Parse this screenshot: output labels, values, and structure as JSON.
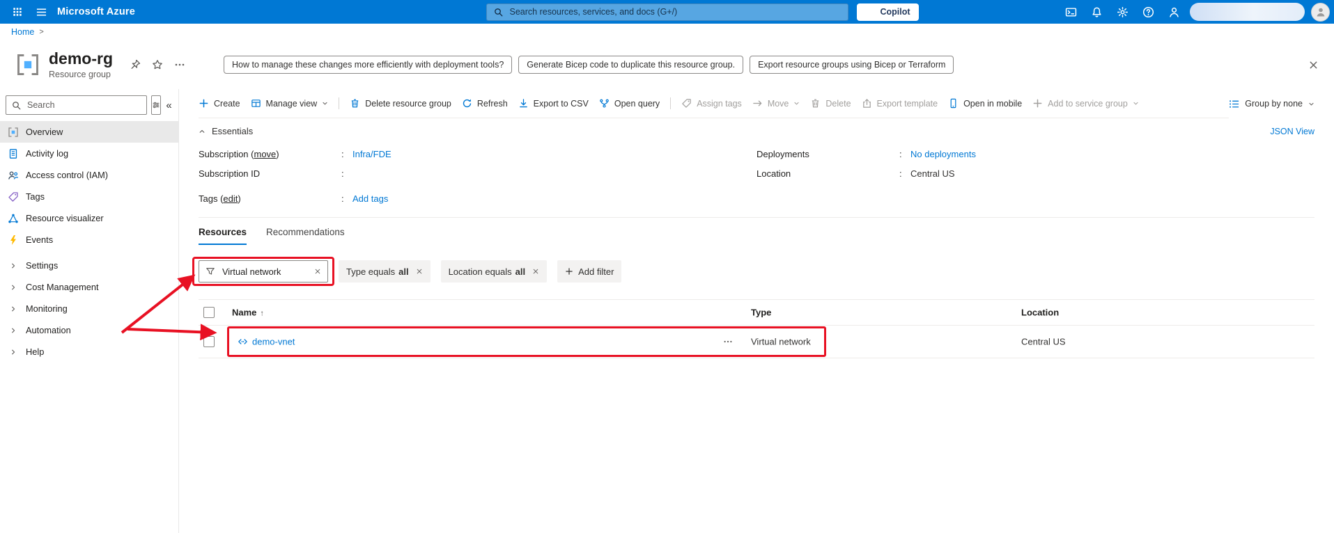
{
  "topbar": {
    "brand": "Microsoft Azure",
    "search_placeholder": "Search resources, services, and docs (G+/)",
    "copilot": "Copilot"
  },
  "breadcrumb": {
    "home": "Home",
    "separator": ">"
  },
  "header": {
    "title": "demo-rg",
    "subtitle": "Resource group",
    "chips": [
      "How to manage these changes more efficiently with deployment tools?",
      "Generate Bicep code to duplicate this resource group.",
      "Export resource groups using Bicep or Terraform"
    ]
  },
  "sidebar": {
    "search_placeholder": "Search",
    "collapse": "«",
    "items": [
      {
        "label": "Overview"
      },
      {
        "label": "Activity log"
      },
      {
        "label": "Access control (IAM)"
      },
      {
        "label": "Tags"
      },
      {
        "label": "Resource visualizer"
      },
      {
        "label": "Events"
      },
      {
        "label": "Settings"
      },
      {
        "label": "Cost Management"
      },
      {
        "label": "Monitoring"
      },
      {
        "label": "Automation"
      },
      {
        "label": "Help"
      }
    ]
  },
  "command_bar": {
    "items": [
      {
        "label": "Create"
      },
      {
        "label": "Manage view"
      },
      {
        "label": "Delete resource group"
      },
      {
        "label": "Refresh"
      },
      {
        "label": "Export to CSV"
      },
      {
        "label": "Open query"
      },
      {
        "label": "Assign tags"
      },
      {
        "label": "Move"
      },
      {
        "label": "Delete"
      },
      {
        "label": "Export template"
      },
      {
        "label": "Open in mobile"
      },
      {
        "label": "Add to service group"
      }
    ],
    "group_by": "Group by none"
  },
  "essentials": {
    "title": "Essentials",
    "json_view": "JSON View",
    "colon": ":",
    "left": [
      {
        "pre": "Subscription (",
        "link": "move",
        "post": ")",
        "value": "Infra/FDE"
      },
      {
        "pre": "Subscription ID",
        "link": "",
        "post": "",
        "value": ""
      },
      {
        "pre": "Tags (",
        "link": "edit",
        "post": ")",
        "value": "Add tags"
      }
    ],
    "right": [
      {
        "label": "Deployments",
        "value": "No deployments"
      },
      {
        "label": "Location",
        "value": "Central US"
      }
    ]
  },
  "tabs": [
    {
      "label": "Resources"
    },
    {
      "label": "Recommendations"
    }
  ],
  "filters": {
    "search_value": "Virtual network",
    "pills": [
      {
        "prefix": "Type equals",
        "value": "all"
      },
      {
        "prefix": "Location equals",
        "value": "all"
      }
    ],
    "add_filter": "Add filter"
  },
  "table": {
    "headers": {
      "name": "Name",
      "sort": "↑",
      "type": "Type",
      "location": "Location"
    },
    "rows": [
      {
        "name": "demo-vnet",
        "type": "Virtual network",
        "location": "Central US"
      }
    ]
  },
  "colors": {
    "accent": "#0078d4",
    "annotation": "#e81123"
  }
}
